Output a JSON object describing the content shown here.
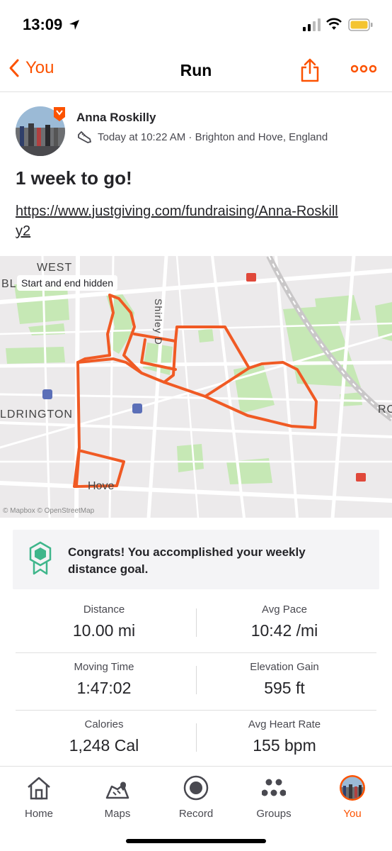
{
  "status": {
    "time": "13:09"
  },
  "header": {
    "back_label": "You",
    "title": "Run"
  },
  "athlete": {
    "name": "Anna Roskilly",
    "meta": "Today at 10:22 AM · Brighton and Hove, England"
  },
  "activity": {
    "title": "1 week to go!",
    "description": "https://www.justgiving.com/fundraising/Anna-Roskilly2"
  },
  "map": {
    "chip": "Start and end hidden",
    "labels": {
      "west": "WEST",
      "bl": "BL",
      "aldrington": "LDRINGTON",
      "shirley": "Shirley D",
      "hove": "Hove",
      "ro": "RO"
    },
    "attribution": "© Mapbox © OpenStreetMap",
    "route_color": "#f05a24"
  },
  "goal": {
    "text": "Congrats! You accomplished your weekly distance goal."
  },
  "stats": [
    {
      "left": {
        "label": "Distance",
        "value": "10.00 mi"
      },
      "right": {
        "label": "Avg Pace",
        "value": "10:42 /mi"
      }
    },
    {
      "left": {
        "label": "Moving Time",
        "value": "1:47:02"
      },
      "right": {
        "label": "Elevation Gain",
        "value": "595 ft"
      }
    },
    {
      "left": {
        "label": "Calories",
        "value": "1,248 Cal"
      },
      "right": {
        "label": "Avg Heart Rate",
        "value": "155 bpm"
      }
    }
  ],
  "tabs": [
    {
      "label": "Home",
      "icon": "home-icon"
    },
    {
      "label": "Maps",
      "icon": "maps-icon"
    },
    {
      "label": "Record",
      "icon": "record-icon"
    },
    {
      "label": "Groups",
      "icon": "groups-icon"
    },
    {
      "label": "You",
      "icon": "profile-avatar-icon",
      "active": true
    }
  ],
  "colors": {
    "accent": "#fc5200",
    "text": "#242428",
    "map_bg": "#eceaeb",
    "park": "#c6e8b5",
    "goal_green": "#3fb68b"
  }
}
